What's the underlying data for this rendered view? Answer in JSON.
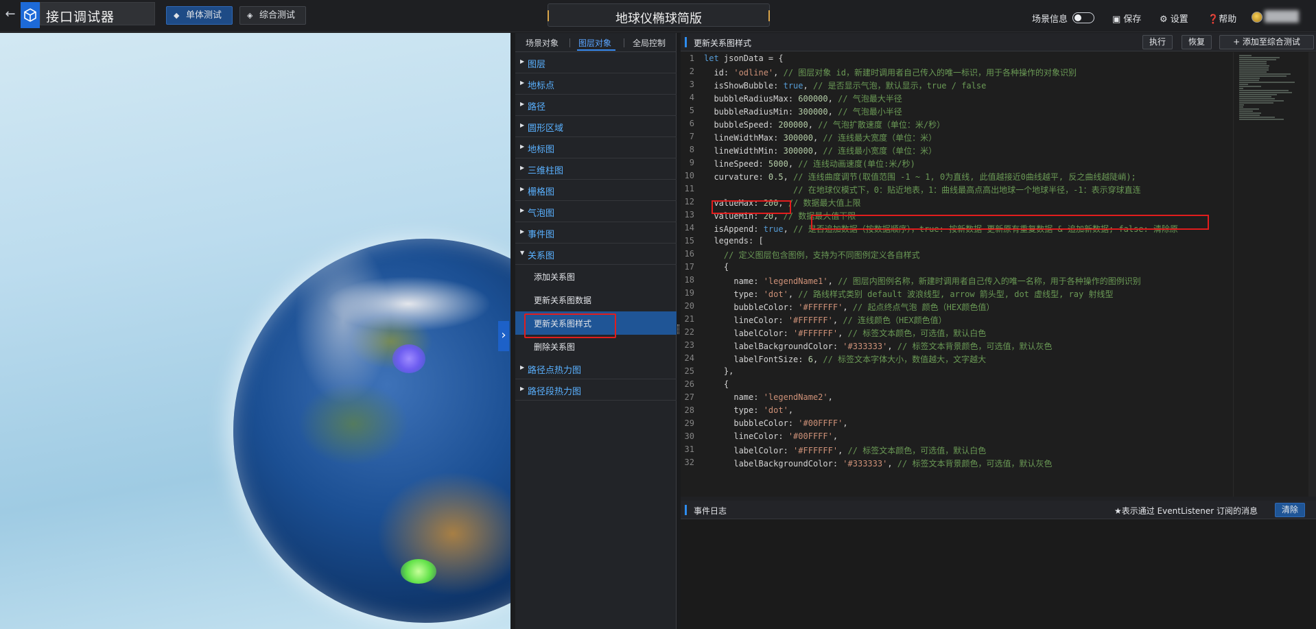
{
  "app": {
    "title": "接口调试器",
    "back_icon": "arrow-left-icon",
    "logo_icon": "cube-logo-icon"
  },
  "top_tabs": [
    {
      "label": "单体测试",
      "active": true
    },
    {
      "label": "综合测试",
      "active": false
    }
  ],
  "scene_title": "地球仪椭球简版",
  "toolbar": {
    "scene_info": "场景信息",
    "save": "保存",
    "settings": "设置",
    "help": "帮助"
  },
  "left_panel": {
    "tabs": [
      "场景对象",
      "图层对象",
      "全局控制"
    ],
    "active_tab": "图层对象",
    "nav": [
      "图层",
      "地标点",
      "路径",
      "圆形区域",
      "地标图",
      "三维柱图",
      "栅格图",
      "气泡图",
      "事件图"
    ],
    "expanded": {
      "label": "关系图",
      "children": [
        "添加关系图",
        "更新关系图数据",
        "更新关系图样式",
        "删除关系图"
      ],
      "active_child": "更新关系图样式"
    },
    "nav_after": [
      "路径点热力图",
      "路径段热力图"
    ]
  },
  "editor": {
    "title": "更新关系图样式",
    "buttons": {
      "run": "执行",
      "restore": "恢复",
      "add_to": "+ 添加至综合测试"
    },
    "lines": [
      [
        [
          "k",
          "let "
        ],
        [
          "",
          "jsonData = {"
        ]
      ],
      [
        [
          "",
          "  id: "
        ],
        [
          "s",
          "'odline'"
        ],
        [
          "",
          ", "
        ],
        [
          "c",
          "// 图层对象 id，新建时调用者自己传入的唯一标识，用于各种操作的对象识别"
        ]
      ],
      [
        [
          "",
          "  isShowBubble: "
        ],
        [
          "k",
          "true"
        ],
        [
          "",
          ", "
        ],
        [
          "c",
          "// 是否显示气泡，默认显示，true / false"
        ]
      ],
      [
        [
          "",
          "  bubbleRadiusMax: "
        ],
        [
          "n",
          "600000"
        ],
        [
          "",
          ", "
        ],
        [
          "c",
          "// 气泡最大半径"
        ]
      ],
      [
        [
          "",
          "  bubbleRadiusMin: "
        ],
        [
          "n",
          "300000"
        ],
        [
          "",
          ", "
        ],
        [
          "c",
          "// 气泡最小半径"
        ]
      ],
      [
        [
          "",
          "  bubbleSpeed: "
        ],
        [
          "n",
          "200000"
        ],
        [
          "",
          ", "
        ],
        [
          "c",
          "// 气泡扩散速度（单位：米/秒）"
        ]
      ],
      [
        [
          "",
          "  lineWidthMax: "
        ],
        [
          "n",
          "300000"
        ],
        [
          "",
          ", "
        ],
        [
          "c",
          "// 连线最大宽度（单位：米）"
        ]
      ],
      [
        [
          "",
          "  lineWidthMin: "
        ],
        [
          "n",
          "300000"
        ],
        [
          "",
          ", "
        ],
        [
          "c",
          "// 连线最小宽度（单位：米）"
        ]
      ],
      [
        [
          "",
          "  lineSpeed: "
        ],
        [
          "n",
          "5000"
        ],
        [
          "",
          ", "
        ],
        [
          "c",
          "// 连线动画速度(单位:米/秒)"
        ]
      ],
      [
        [
          "",
          "  curvature: "
        ],
        [
          "n",
          "0.5"
        ],
        [
          "",
          ", "
        ],
        [
          "c",
          "// 连线曲度调节(取值范围 -1 ~ 1, 0为直线, 此值越接近0曲线越平, 反之曲线越陡峭);"
        ]
      ],
      [
        [
          "",
          "                  "
        ],
        [
          "c",
          "// 在地球仪模式下，0：贴近地表，1：曲线最高点高出地球一个地球半径，-1：表示穿球直连"
        ]
      ],
      [
        [
          "",
          "  valueMax: "
        ],
        [
          "n",
          "200"
        ],
        [
          "",
          ", "
        ],
        [
          "c",
          "// 数据最大值上限"
        ]
      ],
      [
        [
          "",
          "  valueMin: "
        ],
        [
          "n",
          "20"
        ],
        [
          "",
          ", "
        ],
        [
          "c",
          "// 数据最大值下限"
        ]
      ],
      [
        [
          "",
          "  isAppend: "
        ],
        [
          "k",
          "true"
        ],
        [
          "",
          ", "
        ],
        [
          "c",
          "// 是否追加数据（按数据顺序），true: 按新数据 更新原有重复数据 & 追加新数据; false: 清除原"
        ]
      ],
      [
        [
          "",
          "  legends: ["
        ]
      ],
      [
        [
          "",
          "    "
        ],
        [
          "c",
          "// 定义图层包含图例，支持为不同图例定义各自样式"
        ]
      ],
      [
        [
          "",
          "    {"
        ]
      ],
      [
        [
          "",
          "      name: "
        ],
        [
          "s",
          "'legendName1'"
        ],
        [
          "",
          ", "
        ],
        [
          "c",
          "// 图层内图例名称，新建时调用者自己传入的唯一名称，用于各种操作的图例识别"
        ]
      ],
      [
        [
          "",
          "      type: "
        ],
        [
          "s",
          "'dot'"
        ],
        [
          "",
          ", "
        ],
        [
          "c",
          "// 路线样式类别 default 波浪线型, arrow 箭头型, dot 虚线型, ray 射线型"
        ]
      ],
      [
        [
          "",
          "      bubbleColor: "
        ],
        [
          "s",
          "'#FFFFFF'"
        ],
        [
          "",
          ", "
        ],
        [
          "c",
          "// 起点终点气泡 颜色（HEX颜色值）"
        ]
      ],
      [
        [
          "",
          "      lineColor: "
        ],
        [
          "s",
          "'#FFFFFF'"
        ],
        [
          "",
          ", "
        ],
        [
          "c",
          "// 连线颜色（HEX颜色值）"
        ]
      ],
      [
        [
          "",
          "      labelColor: "
        ],
        [
          "s",
          "'#FFFFFF'"
        ],
        [
          "",
          ", "
        ],
        [
          "c",
          "// 标签文本颜色，可选值，默认白色"
        ]
      ],
      [
        [
          "",
          "      labelBackgroundColor: "
        ],
        [
          "s",
          "'#333333'"
        ],
        [
          "",
          ", "
        ],
        [
          "c",
          "// 标签文本背景颜色，可选值，默认灰色"
        ]
      ],
      [
        [
          "",
          "      labelFontSize: "
        ],
        [
          "n",
          "6"
        ],
        [
          "",
          ", "
        ],
        [
          "c",
          "// 标签文本字体大小，数值越大，文字越大"
        ]
      ],
      [
        [
          "",
          "    },"
        ]
      ],
      [
        [
          "",
          "    {"
        ]
      ],
      [
        [
          "",
          "      name: "
        ],
        [
          "s",
          "'legendName2'"
        ],
        [
          "",
          ","
        ]
      ],
      [
        [
          "",
          "      type: "
        ],
        [
          "s",
          "'dot'"
        ],
        [
          "",
          ","
        ]
      ],
      [
        [
          "",
          "      bubbleColor: "
        ],
        [
          "s",
          "'#00FFFF'"
        ],
        [
          "",
          ","
        ]
      ],
      [
        [
          "",
          "      lineColor: "
        ],
        [
          "s",
          "'#00FFFF'"
        ],
        [
          "",
          ","
        ]
      ],
      [
        [
          "",
          "      labelColor: "
        ],
        [
          "s",
          "'#FFFFFF'"
        ],
        [
          "",
          ", "
        ],
        [
          "c",
          "// 标签文本颜色，可选值，默认白色"
        ]
      ],
      [
        [
          "",
          "      labelBackgroundColor: "
        ],
        [
          "s",
          "'#333333'"
        ],
        [
          "",
          ", "
        ],
        [
          "c",
          "// 标签文本背景颜色，可选值，默认灰色"
        ]
      ]
    ]
  },
  "event_log": {
    "title": "事件日志",
    "note": "★表示通过 EventListener 订阅的消息",
    "clear": "清除"
  },
  "colors": {
    "accent": "#2d8cf0",
    "highlight": "#e21d1d",
    "nav_text": "#5ab1ff"
  }
}
